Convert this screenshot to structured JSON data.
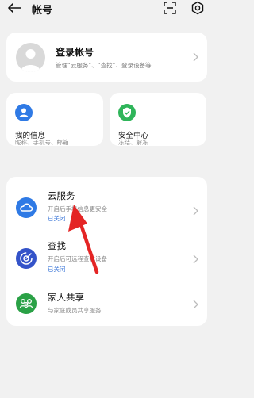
{
  "header": {
    "title": "帐号"
  },
  "login": {
    "title": "登录帐号",
    "subtitle": "管理“云服务”、“查找”、登录设备等"
  },
  "tiles": {
    "myinfo": {
      "title": "我的信息",
      "subtitle": "昵称、手机号、邮箱"
    },
    "security": {
      "title": "安全中心",
      "subtitle": "冻结、解冻"
    }
  },
  "services": [
    {
      "title": "云服务",
      "subtitle": "开启后手机信息更安全",
      "status": "已关闭"
    },
    {
      "title": "查找",
      "subtitle": "开启后可远程查找设备",
      "status": "已关闭"
    },
    {
      "title": "家人共享",
      "subtitle": "与家庭成员共享服务"
    }
  ],
  "colors": {
    "accent_blue": "#2f7ae5",
    "security_green": "#2fb55a",
    "find_blue": "#3453c9",
    "family_green": "#2aa146",
    "annotation_red": "#e42525"
  },
  "icons": {
    "back": "back-arrow-icon",
    "scan": "scan-icon",
    "settings": "gear-icon",
    "avatar": "avatar-placeholder-icon",
    "myinfo": "person-icon",
    "security": "shield-check-icon",
    "cloud": "cloud-icon",
    "find": "radar-icon",
    "family": "family-icon"
  }
}
